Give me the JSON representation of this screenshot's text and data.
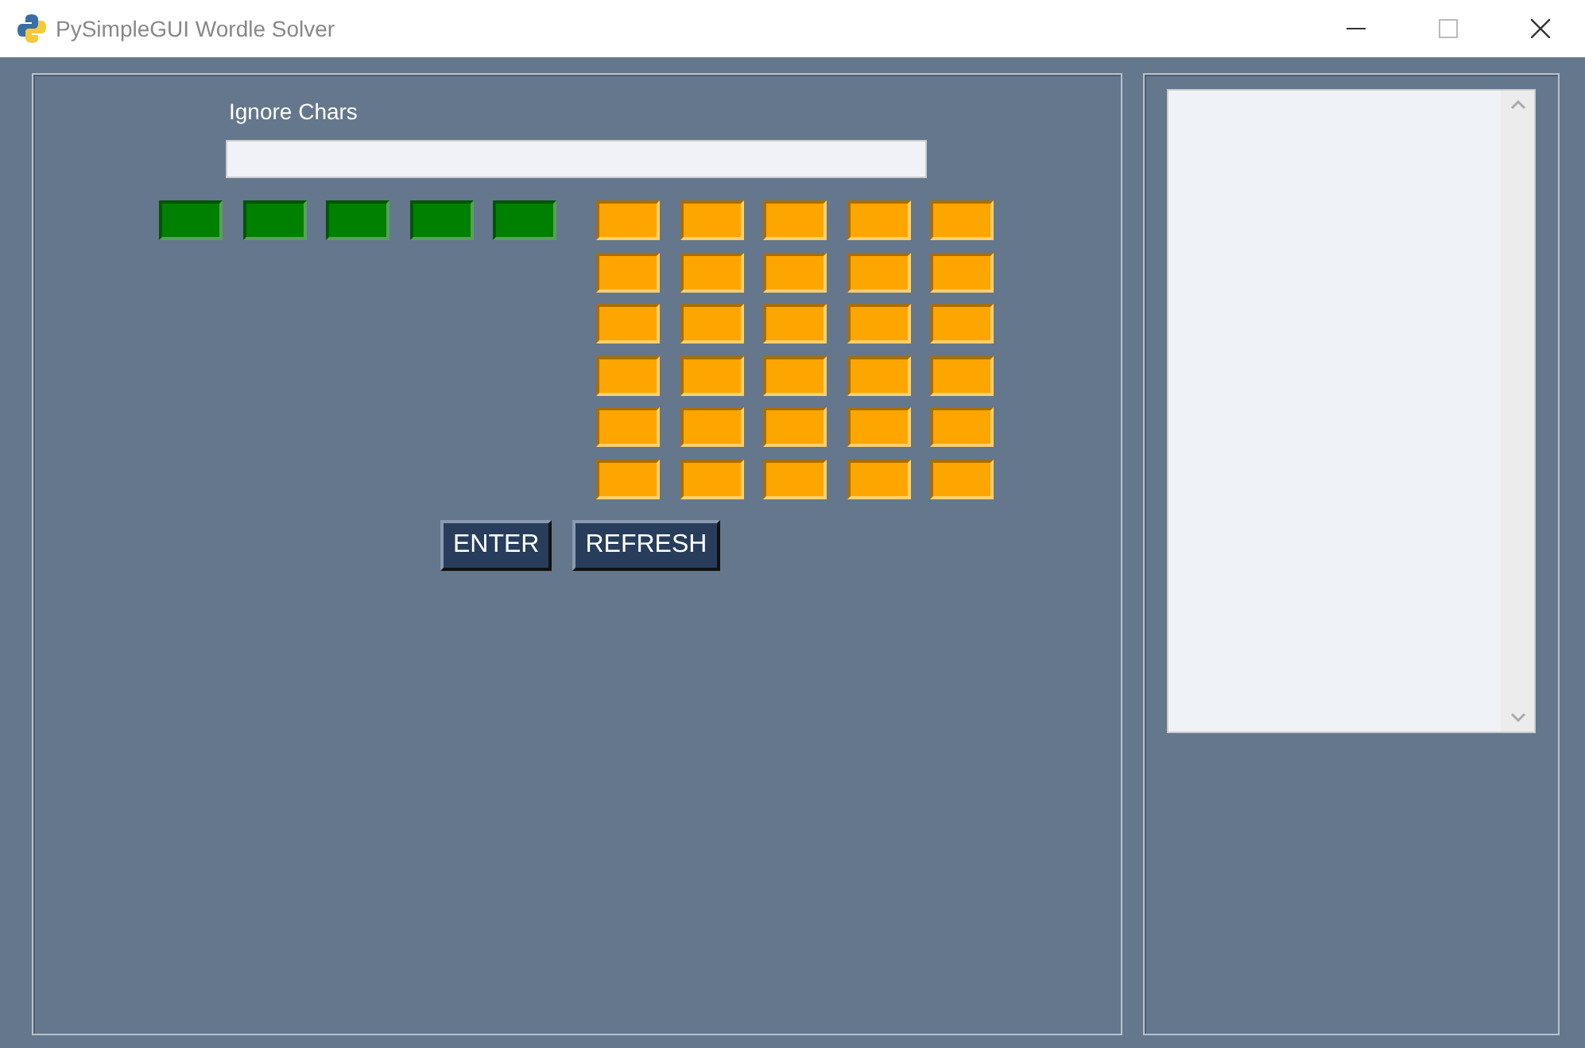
{
  "window": {
    "title": "PySimpleGUI Wordle Solver"
  },
  "ignore_chars": {
    "label": "Ignore Chars"
  },
  "known_letters": [
    {
      "color": "#008000"
    },
    {
      "color": "#008000"
    },
    {
      "color": "#008000"
    },
    {
      "color": "#008000"
    },
    {
      "color": "#008000"
    }
  ],
  "guess_rows": [
    [
      {
        "color": "#ffa500"
      },
      {
        "color": "#ffa500"
      },
      {
        "color": "#ffa500"
      },
      {
        "color": "#ffa500"
      },
      {
        "color": "#ffa500"
      }
    ],
    [
      {
        "color": "#ffa500"
      },
      {
        "color": "#ffa500"
      },
      {
        "color": "#ffa500"
      },
      {
        "color": "#ffa500"
      },
      {
        "color": "#ffa500"
      }
    ],
    [
      {
        "color": "#ffa500"
      },
      {
        "color": "#ffa500"
      },
      {
        "color": "#ffa500"
      },
      {
        "color": "#ffa500"
      },
      {
        "color": "#ffa500"
      }
    ],
    [
      {
        "color": "#ffa500"
      },
      {
        "color": "#ffa500"
      },
      {
        "color": "#ffa500"
      },
      {
        "color": "#ffa500"
      },
      {
        "color": "#ffa500"
      }
    ],
    [
      {
        "color": "#ffa500"
      },
      {
        "color": "#ffa500"
      },
      {
        "color": "#ffa500"
      },
      {
        "color": "#ffa500"
      },
      {
        "color": "#ffa500"
      }
    ],
    [
      {
        "color": "#ffa500"
      },
      {
        "color": "#ffa500"
      },
      {
        "color": "#ffa500"
      },
      {
        "color": "#ffa500"
      },
      {
        "color": "#ffa500"
      }
    ]
  ],
  "buttons": [
    "ENTER",
    "REFRESH"
  ]
}
